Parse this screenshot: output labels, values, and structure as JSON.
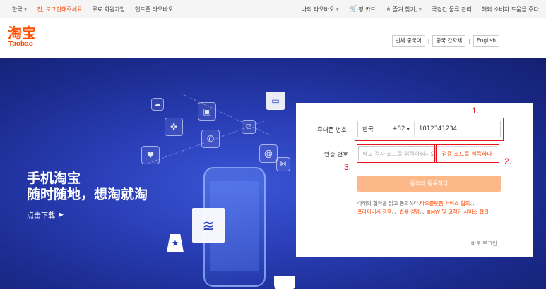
{
  "topbar": {
    "lang": "한국",
    "greeting": "친, 로그인해주세요",
    "signup": "무료 회원가입",
    "mobile": "핸드폰 타오바오",
    "my_taobao": "나의 타오바오",
    "cart": "핑 카트",
    "favorites": "즐겨 찾기,",
    "logistics": "국경간 물류 관리",
    "help": "해외 소비자 도움을 주다"
  },
  "header": {
    "logo_cn": "淘宝",
    "logo_en": "Taobao",
    "lang_options": [
      "번체 중국어",
      "중국 간자체",
      "English"
    ]
  },
  "banner": {
    "title": "手机淘宝",
    "subtitle": "随时随地，想淘就淘",
    "download": "点击下载"
  },
  "login": {
    "phone_label": "휴대폰 번호",
    "country": "한국",
    "country_code": "+82",
    "phone_value": "1012341234",
    "code_label": "인증 번호",
    "code_placeholder": "학교 검사 코드를 입력하십시오",
    "get_code": "검증 코드를 획득하다",
    "agree_button": "동의와 등록하다",
    "terms_prefix": "아래의 협약을 읽고 동의하다.",
    "terms_link1": "타오플랫폼 서비스 협의",
    "terms_sep1": "、、",
    "terms_link2": "프라이버시 정책",
    "terms_sep2": "、、",
    "terms_link3": "법률 성명",
    "terms_sep3": "、、",
    "terms_link4": "BMW 및 고객단 서비스 협의",
    "pc_login": "바로 로그인"
  },
  "annotations": {
    "one": "1.",
    "two": "2.",
    "three": "3."
  },
  "colors": {
    "brand": "#ff5000",
    "annotation": "#e8151c",
    "button": "#fdb88a"
  }
}
